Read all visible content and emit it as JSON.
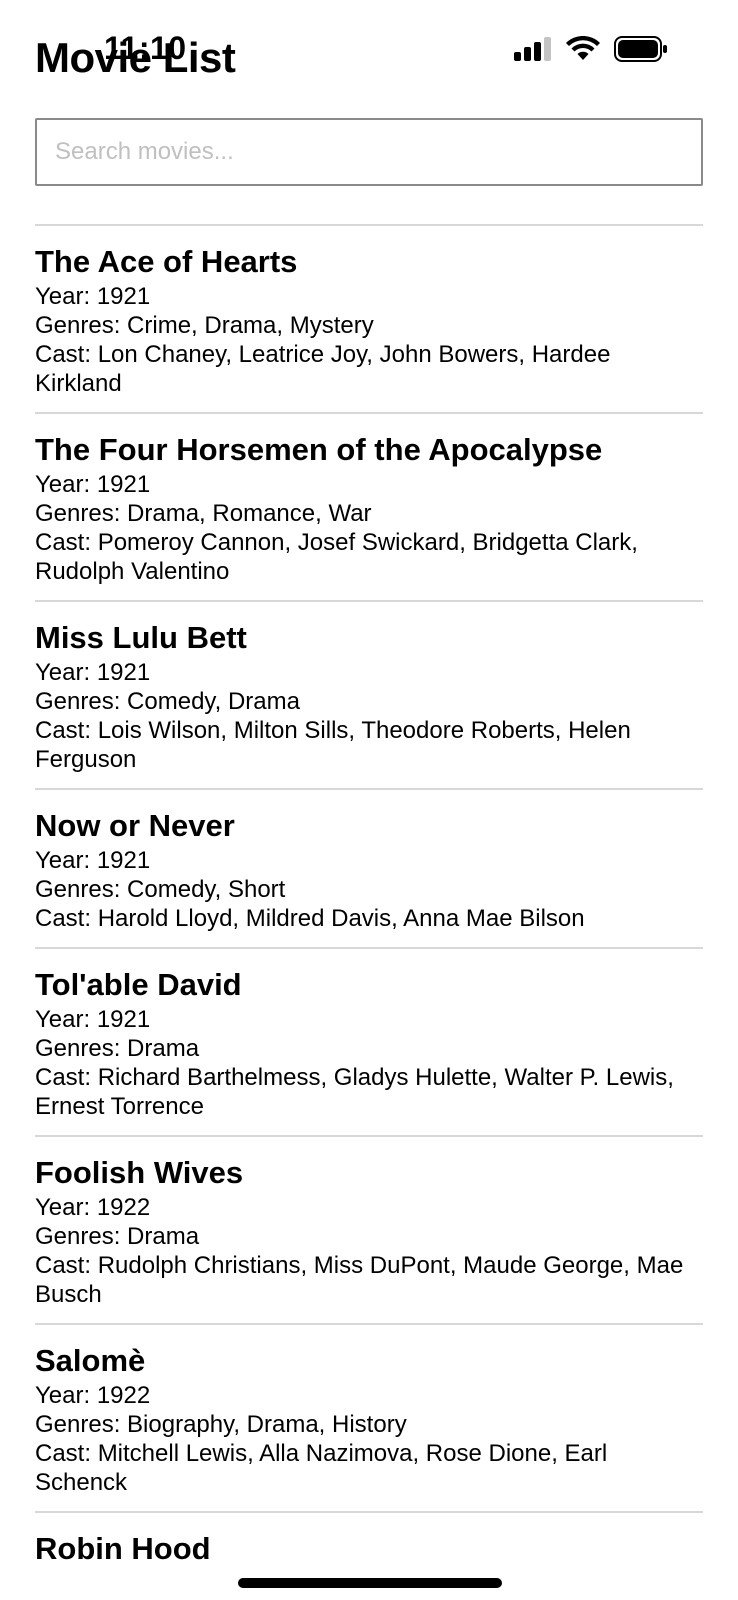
{
  "status_bar": {
    "time": "11:10",
    "icons": [
      "cellular-signal-icon",
      "wifi-icon",
      "battery-icon"
    ]
  },
  "header": {
    "title": "Movie List"
  },
  "search": {
    "placeholder": "Search movies...",
    "value": ""
  },
  "labels": {
    "year": "Year: ",
    "genres": "Genres: ",
    "cast": "Cast: "
  },
  "movies": [
    {
      "title": "The Ace of Hearts",
      "year": "1921",
      "genres": "Crime, Drama, Mystery",
      "cast": "Lon Chaney, Leatrice Joy, John Bowers, Hardee Kirkland"
    },
    {
      "title": "The Four Horsemen of the Apocalypse",
      "year": "1921",
      "genres": "Drama, Romance, War",
      "cast": "Pomeroy Cannon, Josef Swickard, Bridgetta Clark, Rudolph Valentino"
    },
    {
      "title": "Miss Lulu Bett",
      "year": "1921",
      "genres": "Comedy, Drama",
      "cast": "Lois Wilson, Milton Sills, Theodore Roberts, Helen Ferguson"
    },
    {
      "title": "Now or Never",
      "year": "1921",
      "genres": "Comedy, Short",
      "cast": "Harold Lloyd, Mildred Davis, Anna Mae Bilson"
    },
    {
      "title": "Tol'able David",
      "year": "1921",
      "genres": "Drama",
      "cast": "Richard Barthelmess, Gladys Hulette, Walter P. Lewis, Ernest Torrence"
    },
    {
      "title": "Foolish Wives",
      "year": "1922",
      "genres": "Drama",
      "cast": "Rudolph Christians, Miss DuPont, Maude George, Mae Busch"
    },
    {
      "title": "Salomè",
      "year": "1922",
      "genres": "Biography, Drama, History",
      "cast": "Mitchell Lewis, Alla Nazimova, Rose Dione, Earl Schenck"
    },
    {
      "title": "Robin Hood",
      "year": "",
      "genres": "",
      "cast": ""
    }
  ]
}
